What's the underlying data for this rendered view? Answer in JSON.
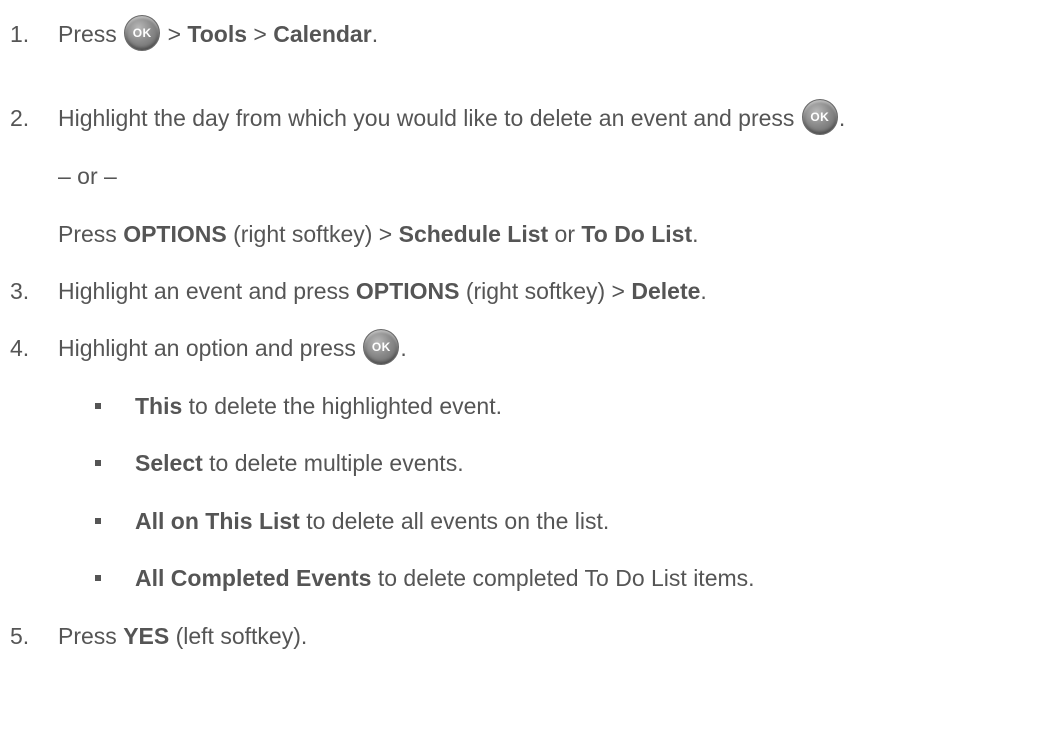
{
  "ok_icon_label": "OK",
  "steps": [
    {
      "num": "1.",
      "parts": [
        "Press ",
        " > ",
        "Tools",
        " > ",
        "Calendar",
        "."
      ]
    },
    {
      "num": "2.",
      "parts": [
        "Highlight the day from which you would like to delete an event and press ",
        "."
      ]
    },
    {
      "or_text": "– or –"
    },
    {
      "parts": [
        "Press ",
        "OPTIONS",
        " (right softkey) > ",
        "Schedule List",
        " or ",
        "To Do List",
        "."
      ]
    },
    {
      "num": "3.",
      "parts": [
        "Highlight an event and press ",
        "OPTIONS",
        " (right softkey) > ",
        "Delete",
        "."
      ]
    },
    {
      "num": "4.",
      "parts": [
        "Highlight an option and press ",
        "."
      ]
    }
  ],
  "options": [
    {
      "term": "This",
      "desc": " to delete the highlighted event."
    },
    {
      "term": "Select",
      "desc": " to delete multiple events."
    },
    {
      "term": "All on This List",
      "desc": " to delete all events on the list."
    },
    {
      "term": "All Completed Events",
      "desc": " to delete completed To Do List items."
    }
  ],
  "step5": {
    "num": "5.",
    "parts": [
      "Press ",
      "YES",
      " (left softkey)."
    ]
  }
}
